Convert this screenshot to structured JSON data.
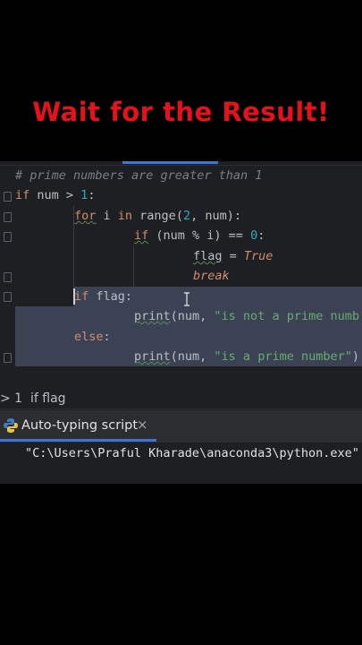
{
  "caption": "Wait for the Result!",
  "editor": {
    "comment": "# prime numbers are greater than 1",
    "lines": {
      "l1_kw": "if",
      "l1_rest": " num > ",
      "l1_num": "1",
      "l1_end": ":",
      "l2_kw": "for",
      "l2_mid": " i ",
      "l2_in": "in",
      "l2_fn": " range",
      "l2_a": "(",
      "l2_n2": "2",
      "l2_b": ", num):",
      "l3_kw": "if",
      "l3_a": " (num % i) == ",
      "l3_n0": "0",
      "l3_b": ":",
      "l4_var": "flag",
      "l4_eq": " = ",
      "l4_true": "True",
      "l5_break": "break",
      "l6_kw": "if",
      "l6_rest": " flag:",
      "l7_print": "print",
      "l7_a": "(num, ",
      "l7_str": "\"is not a prime numb",
      "l8_else": "else",
      "l8_colon": ":",
      "l9_print": "print",
      "l9_a": "(num, ",
      "l9_str": "\"is a prime number\"",
      "l9_end": ")"
    }
  },
  "breadcrumb": {
    "prefix": "> 1",
    "item": "if flag"
  },
  "run_panel": {
    "tab_label": "Auto-typing script",
    "close_glyph": "×",
    "console_output": "\"C:\\Users\\Praful Kharade\\anaconda3\\python.exe\""
  },
  "colors": {
    "caption": "#e8101a",
    "keyword": "#cf8e6d",
    "number": "#2aacb8",
    "string": "#6aab73",
    "accent": "#3d74d6"
  },
  "icons": {
    "run_tab": "python-icon",
    "text_cursor": "i-beam-cursor-icon"
  }
}
